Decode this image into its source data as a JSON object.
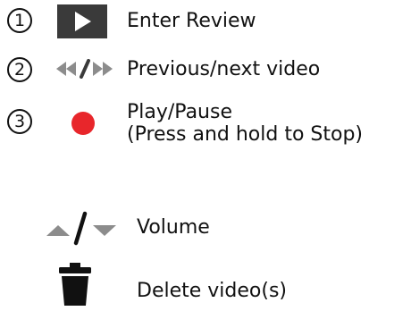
{
  "items": [
    {
      "number": "1",
      "icon": "play-button-icon",
      "label": "Enter Review"
    },
    {
      "number": "2",
      "icon": "previous-next-icon",
      "label": "Previous/next video"
    },
    {
      "number": "3",
      "icon": "record-dot-icon",
      "label_line1": "Play/Pause",
      "label_line2": "(Press and hold to Stop)"
    }
  ],
  "extras": [
    {
      "icon": "volume-up-down-icon",
      "label": "Volume"
    },
    {
      "icon": "trash-icon",
      "label": "Delete video(s)"
    }
  ],
  "colors": {
    "play_button_bg": "#3a3a3a",
    "arrow_gray": "#8c8c8c",
    "record_red": "#e8262b",
    "text": "#111111"
  }
}
